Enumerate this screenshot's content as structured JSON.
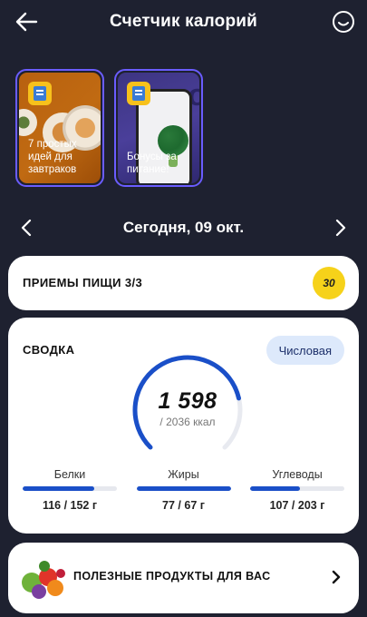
{
  "header": {
    "title": "Счетчик калорий",
    "back_icon": "arrow-left-icon",
    "profile_icon": "smile-face-icon"
  },
  "stories": [
    {
      "text": "7 простых идей для завтраков",
      "badge_icon": "book-icon"
    },
    {
      "text": "Бонусы за питание!",
      "badge_icon": "book-icon"
    }
  ],
  "date_nav": {
    "label": "Сегодня, 09 окт.",
    "prev_icon": "chevron-left-icon",
    "next_icon": "chevron-right-icon"
  },
  "meals": {
    "label": "ПРИЕМЫ ПИЩИ 3/3",
    "badge": "30"
  },
  "summary": {
    "title": "СВОДКА",
    "mode": "Числовая",
    "kcal_value": "1 598",
    "kcal_limit": "/ 2036 ккал",
    "progress_fraction": 0.785,
    "macros": [
      {
        "name": "Белки",
        "value": "116 / 152 г",
        "fraction": 0.76
      },
      {
        "name": "Жиры",
        "value": "77 / 67 г",
        "fraction": 1.0
      },
      {
        "name": "Углеводы",
        "value": "107 / 203 г",
        "fraction": 0.53
      }
    ]
  },
  "useful": {
    "label": "ПОЛЕЗНЫЕ ПРОДУКТЫ ДЛЯ ВАС",
    "icon": "chevron-right-icon"
  },
  "colors": {
    "background": "#1e2130",
    "accent": "#1a4fc8",
    "badge_yellow": "#f6d21a",
    "pill_bg": "#dde9fb"
  }
}
